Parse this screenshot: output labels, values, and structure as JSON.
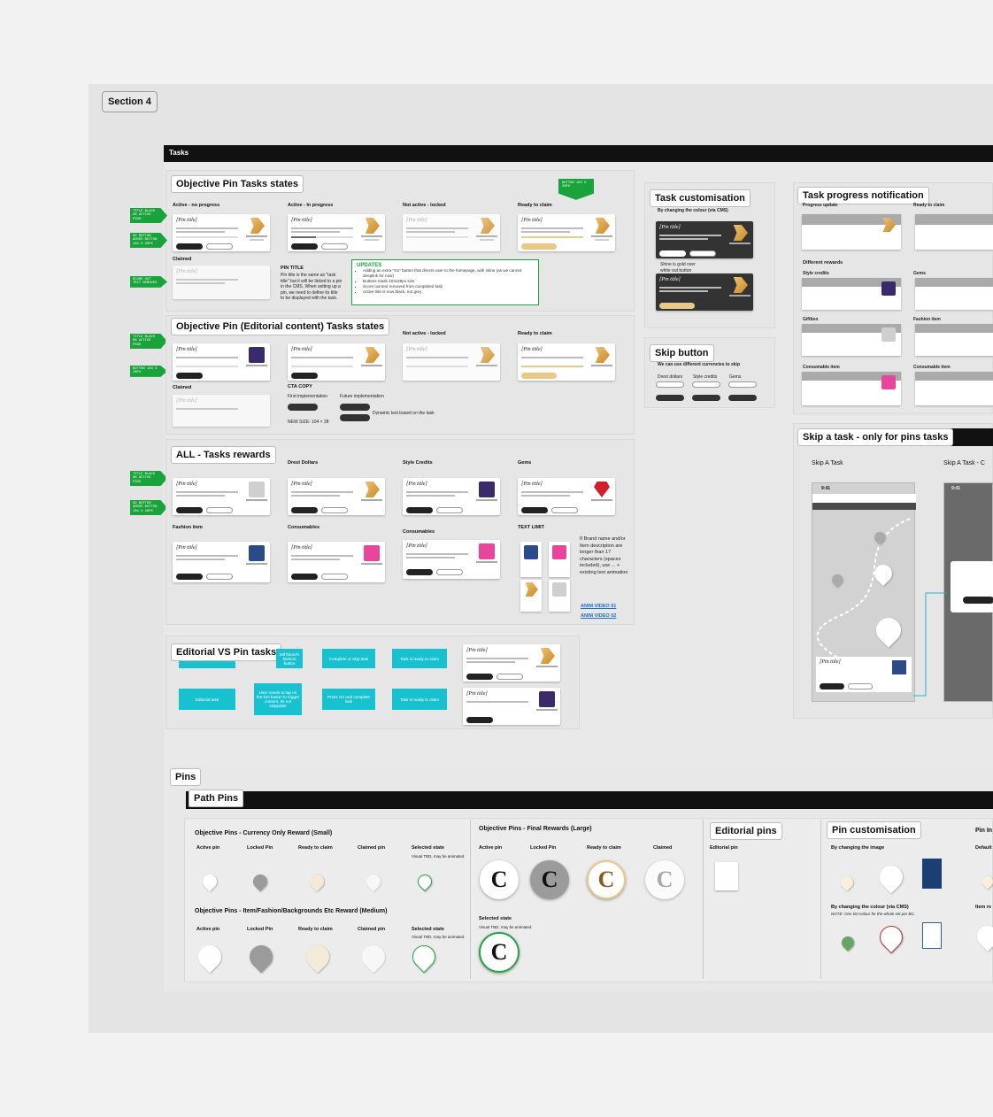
{
  "section": "Section 4",
  "tasks_bar": "Tasks",
  "pins_tag": "Pins",
  "path_pins_tag": "Path Pins",
  "obj_states": {
    "title": "Objective Pin Tasks states",
    "col1": "Active - no progress",
    "col2": "Active - In progress",
    "col3": "Not active - locked",
    "col4": "Ready to claim",
    "claimed": "Claimed",
    "pin_title": "PIN TITLE",
    "pin_title_desc": "Pin title is the same as \"task title\" but it will be linked to a pin in the CMS. When setting up a pin, we need to define its title to be displayed with the task.",
    "updates_head": "UPDATES",
    "updates": [
      "Adding an extra \"Go\" button that directs user to the homepage, with inline (as we cannot deeplink for now)",
      "Buttons mask 104x28px size",
      "Score out text removed from completed task",
      "Active title is now black, not grey"
    ]
  },
  "editorial_states": {
    "title": "Objective Pin (Editorial content) Tasks states",
    "col3": "Not active - locked",
    "col4": "Ready to claim",
    "claimed": "Claimed",
    "cta": "CTA COPY",
    "first": "First implementation",
    "future": "Future implementation",
    "dynamic": "Dynamic text based on the task",
    "newsize": "NEW SIZE: 104 × 28"
  },
  "rewards": {
    "title": "ALL - Tasks rewards",
    "drest": "Drest Dollars",
    "style": "Style Credits",
    "gems": "Gems",
    "fashion": "Fashion item",
    "consumables": "Consumables",
    "consumables2": "Consumables",
    "textlimit": "TEXT LIMIT",
    "limit_note": "If Brand name and/or Item description are longer than 17 characters (spaces included), use ... + existing text animation",
    "anim1": "ANIM VIDEO 01",
    "anim2": "ANIM VIDEO 02"
  },
  "arrows": [
    "TITLE BLACK ON ACTIVE PINS",
    "GO BUTTON ADDED BUTTON 104 X 28PX",
    "SCORE OUT TEXT REMOVED",
    "TITLE BLACK ON ACTIVE PINS",
    "BUTTON 104 X 28PX",
    "TITLE BLACK ON ACTIVE PINS",
    "GO BUTTON ADDED BUTTON 104 X 28PX"
  ],
  "arrow_down": "BUTTON 104 X 28PX",
  "editorial_vs": {
    "title": "Editorial VS Pin tasks",
    "b1": "Editorial task",
    "b2": "User needs to tap on the GO button to trigger content. Its not skippable",
    "b3": "Press Go and complete task",
    "b4": "Task is ready to claim",
    "b5": "Complete or skip task",
    "b6": "Task is ready to claim",
    "b7": "tell friend's fashion button"
  },
  "customisation": {
    "title": "Task customisation",
    "sub": "By changing the colour (via CMS)",
    "caption": "Shine is gold over white out button"
  },
  "skip_button": {
    "title": "Skip button",
    "sub": "We can use different currencies to skip",
    "c1": "Drest dollars",
    "c2": "Style credits",
    "c3": "Gems"
  },
  "progress_notif": {
    "title": "Task progress notification",
    "sub1": "Progress update",
    "sub2": "Ready to claim",
    "diff": "Different rewards",
    "style": "Style credits",
    "gems": "Gems",
    "giftbox": "Giftbox",
    "fashion": "Fashion item",
    "cons": "Consumable item",
    "cons2": "Consumable item"
  },
  "skip_task": {
    "title": "Skip a task - only for pins tasks",
    "a": "Skip A Task",
    "b": "Skip A Task - C",
    "time": "9:41"
  },
  "currency_pins": {
    "title": "Objective Pins - Currency Only Reward (Small)",
    "c1": "Active pin",
    "c2": "Locked Pin",
    "c3": "Ready to claim",
    "c4": "Claimed pin",
    "c5": "Selected state",
    "c5b": "Visual TBD, may be animated"
  },
  "item_pins": {
    "title": "Objective Pins - Item/Fashion/Backgrounds Etc Reward (Medium)",
    "c1": "Active pin",
    "c2": "Locked Pin",
    "c3": "Ready to claim",
    "c4": "Claimed pin",
    "c5": "Selected state",
    "c5b": "Visual TBD, may be animated"
  },
  "final_pins": {
    "title": "Objective Pins - Final Rewards (Large)",
    "c1": "Active pin",
    "c2": "Locked Pin",
    "c3": "Ready to claim",
    "c4": "Claimed",
    "sel": "Selected state",
    "selb": "Visual TBD, may be animated"
  },
  "editorial_pins": {
    "title": "Editorial pins",
    "sub": "Editorial pin"
  },
  "pin_custom": {
    "title": "Pin customisation",
    "img": "By changing the image",
    "col": "By changing the colour (via CMS)",
    "note": "NOTE: One tint colour for the whole set per BC."
  },
  "pin_right": {
    "t": "Pin In",
    "d": "Default",
    "i": "Item re"
  },
  "card_title": "[Pin title]",
  "phone_title": "[Pin title]",
  "letters": "C"
}
